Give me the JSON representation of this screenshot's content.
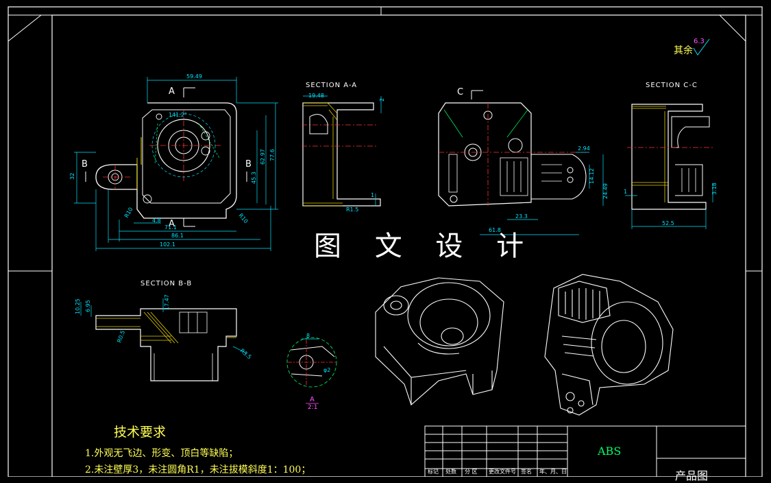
{
  "watermark": "图 文 设 计",
  "roughness": {
    "prefix": "其余",
    "value": "6.3"
  },
  "sections": {
    "aa": "SECTION A-A",
    "bb": "SECTION B-B",
    "cc": "SECTION C-C"
  },
  "view_labels": {
    "a_top": "A",
    "a_bottom": "A",
    "b_left": "B",
    "b_right": "B",
    "c_top": "C",
    "detail_a": "A",
    "detail_scale": "2:1"
  },
  "dims_main": {
    "d_59_49": "59.49",
    "d_71_1": "71.1",
    "d_86_1": "86.1",
    "d_102_1": "102.1",
    "d_77_6": "77.6",
    "d_62_97": "62.97",
    "d_45_3": "45.3",
    "d_32": "32",
    "d_r10": "R10",
    "d_4_8": "4.8",
    "d_141": "141.2°",
    "d_r10b": "R10"
  },
  "dims_aa": {
    "d_19_48": "19.48",
    "d_2": "2",
    "d_r15": "R1.5",
    "d_1": "1"
  },
  "dims_c": {
    "d_2_94": "2.94",
    "d_14_12": "14.12",
    "d_24_49": "24.49",
    "d_23_3": "23.3",
    "d_61_8": "61.8"
  },
  "dims_cc": {
    "d_52_5": "52.5",
    "d_3_18": "3.18",
    "d_1": "1"
  },
  "dims_bb": {
    "d_10_25": "10.25",
    "d_6_95": "6.95",
    "d_17_47": "17.47",
    "d_r3_5": "R3.5",
    "d_r0_5": "R0.5"
  },
  "dims_detail": {
    "d_8": "8",
    "d_phi": "φ2"
  },
  "tech": {
    "title": "技术要求",
    "line1": "1.外观无飞边、形变、顶白等缺陷；",
    "line2": "2.未注壁厚3，未注圆角R1，未注拔模斜度1：100；"
  },
  "title_block": {
    "headers": [
      "标记",
      "处数",
      "分 区",
      "更改文件号",
      "签名",
      "年、月、日"
    ],
    "material": "ABS",
    "product": "产品图"
  },
  "colors": {
    "frame": "#ffffff",
    "dim": "#00e5ff",
    "hatch": "#e6d000",
    "center": "#ff3333",
    "text": "#ffff55",
    "material": "#00ff66"
  }
}
